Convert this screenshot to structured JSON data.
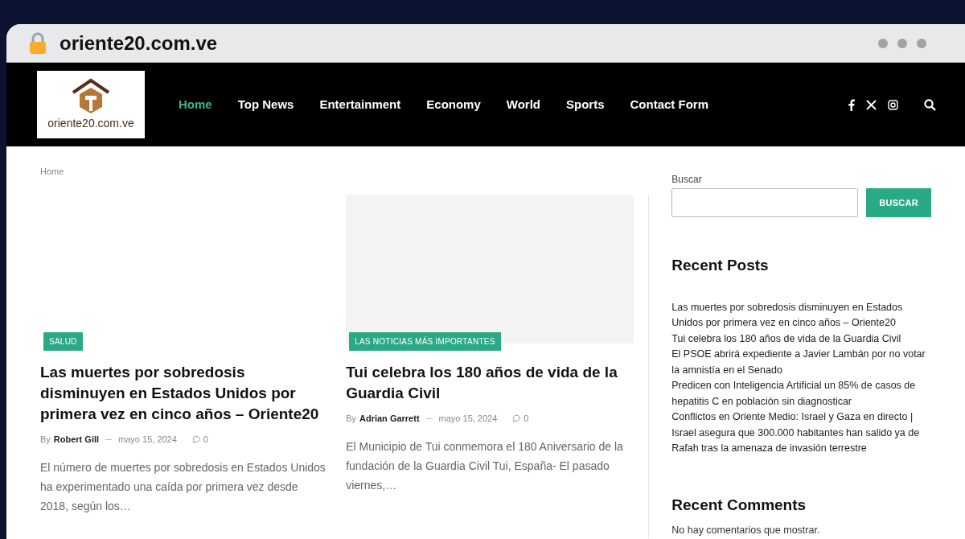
{
  "browser": {
    "url": "oriente20.com.ve"
  },
  "header": {
    "logo_text": "oriente20.com.ve",
    "nav": [
      {
        "label": "Home",
        "selected": true
      },
      {
        "label": "Top News",
        "selected": false
      },
      {
        "label": "Entertainment",
        "selected": false
      },
      {
        "label": "Economy",
        "selected": false
      },
      {
        "label": "World",
        "selected": false
      },
      {
        "label": "Sports",
        "selected": false
      },
      {
        "label": "Contact Form",
        "selected": false
      }
    ]
  },
  "breadcrumb": "Home",
  "articles": [
    {
      "category": "SALUD",
      "title": "Las muertes por sobredosis disminuyen en Estados Unidos por primera vez en cinco años – Oriente20",
      "by": "By",
      "author": "Robert Gill",
      "date": "mayo 15, 2024",
      "comments": "0",
      "excerpt": "El número de muertes por sobredosis en Estados Unidos ha experimentado una caída por primera vez desde 2018, según los…"
    },
    {
      "category": "LAS NOTICIAS MÁS IMPORTANTES",
      "title": "Tui celebra los 180 años de vida de la Guardia Civil",
      "by": "By",
      "author": "Adrian Garrett",
      "date": "mayo 15, 2024",
      "comments": "0",
      "excerpt": "El Municipio de Tui conmemora el 180 Aniversario de la fundación de la Guardia Civil Tui, España- El pasado viernes,…"
    }
  ],
  "sidebar": {
    "search_label": "Buscar",
    "search_button": "BUSCAR",
    "recent_posts_title": "Recent Posts",
    "recent_posts": [
      "Las muertes por sobredosis disminuyen en Estados Unidos por primera vez en cinco años – Oriente20",
      "Tui celebra los 180 años de vida de la Guardia Civil",
      "El PSOE abrirá expediente a Javier Lambán por no votar la amnistía en el Senado",
      "Predicen con Inteligencia Artificial un 85% de casos de hepatitis C en población sin diagnosticar",
      "Conflictos en Oriente Medio: Israel y Gaza en directo | Israel asegura que 300.000 habitantes han salido ya de Rafah tras la amenaza de invasión terrestre"
    ],
    "recent_comments_title": "Recent Comments",
    "recent_comments_text": "No hay comentarios que mostrar."
  }
}
